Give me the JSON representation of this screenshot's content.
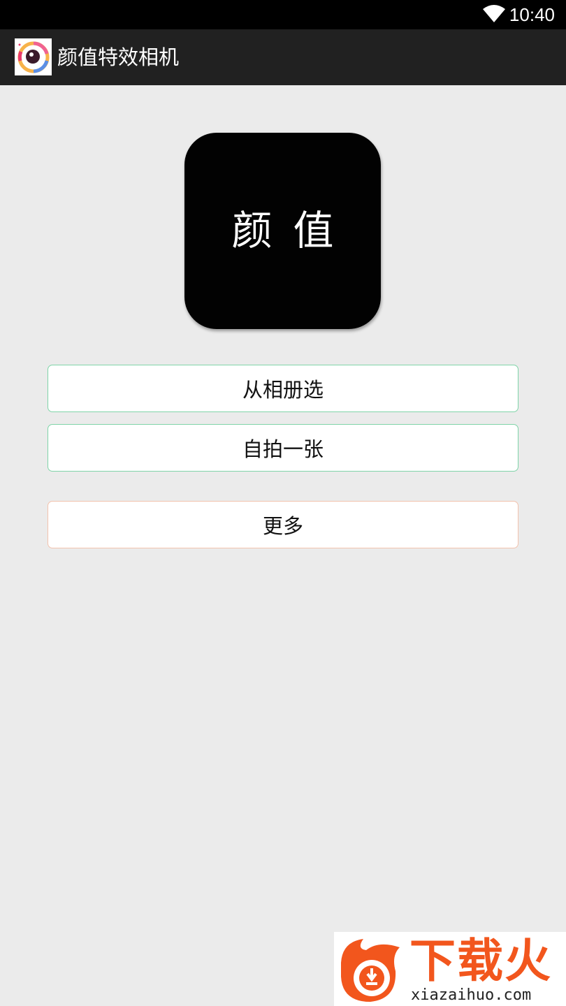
{
  "status_bar": {
    "time": "10:40",
    "wifi_icon": "wifi-icon"
  },
  "action_bar": {
    "title": "颜值特效相机",
    "app_icon": "camera-lens-icon"
  },
  "logo": {
    "text": "颜值"
  },
  "buttons": {
    "album": "从相册选",
    "selfie": "自拍一张",
    "more": "更多"
  },
  "colors": {
    "status_bar_bg": "#000000",
    "action_bar_bg": "#212121",
    "page_bg": "#ebebeb",
    "primary_button_border": "#7fd4a8",
    "more_button_border": "#f2c2ad",
    "watermark_accent": "#f2561d"
  },
  "watermark": {
    "brand": "下载火",
    "url": "xiazaihuo.com",
    "icon": "flame-download-icon"
  }
}
